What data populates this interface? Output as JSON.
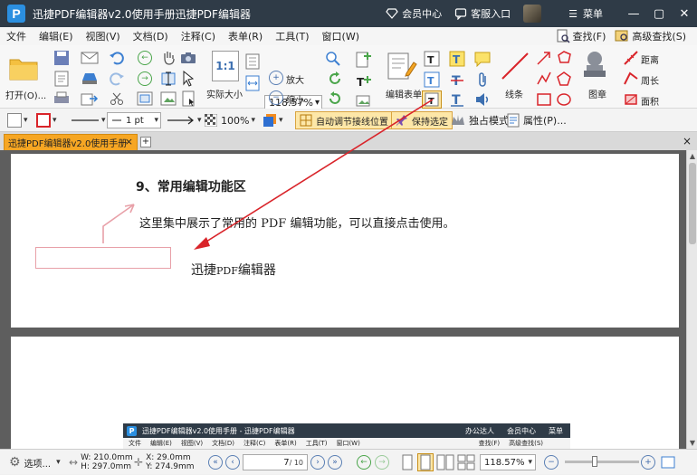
{
  "window": {
    "title": "迅捷PDF编辑器v2.0使用手册迅捷PDF编辑器",
    "logo_letter": "P",
    "member_label": "会员中心",
    "service_label": "客服入口",
    "menu_label": "菜单"
  },
  "menubar": {
    "items": [
      "文件",
      "编辑(E)",
      "视图(V)",
      "文档(D)",
      "注释(C)",
      "表单(R)",
      "工具(T)",
      "窗口(W)"
    ],
    "find_label": "查找(F)",
    "advanced_find_label": "高级查找(S)"
  },
  "ribbon": {
    "open_label": "打开(O)...",
    "zoom_value": "118.57%",
    "actual_size_label": "实际大小",
    "actual_size_glyph": "1:1",
    "zoom_in_label": "放大",
    "zoom_out_label": "缩小",
    "edit_form_label": "编辑表单",
    "line_label": "线条",
    "stamp_label": "图章",
    "distance_label": "距离",
    "perimeter_label": "周长",
    "area_label": "面积"
  },
  "propbar": {
    "line_width": "1 pt",
    "opacity": "100%",
    "auto_adjust_label": "自动调节接线位置",
    "keep_selected_label": "保持选定",
    "exclusive_mode_label": "独占模式",
    "properties_label": "属性(P)..."
  },
  "tabs": {
    "doc_tab_label": "迅捷PDF编辑器v2.0使用手册",
    "close_glyph": "×",
    "add_glyph": "+"
  },
  "document": {
    "heading": "9、常用编辑功能区",
    "paragraph": "这里集中展示了常用的 PDF 编辑功能，可以直接点击使用。",
    "brand_part1": "迅捷",
    "brand_part2": "PDF",
    "brand_part3": "编辑器"
  },
  "mini_window": {
    "title": "迅捷PDF编辑器v2.0使用手册 - 迅捷PDF编辑器",
    "office_label": "办公达人",
    "member_label": "会员中心",
    "menu_label": "菜单",
    "menu_items": [
      "文件",
      "编辑(E)",
      "视图(V)",
      "文档(D)",
      "注释(C)",
      "表单(R)",
      "工具(T)",
      "窗口(W)"
    ],
    "find_label": "查找(F)",
    "adv_label": "高级查找(S)"
  },
  "statusbar": {
    "options_label": "选项...",
    "width": "W: 210.0mm",
    "height": "H: 297.0mm",
    "x": "X:    29.0mm",
    "y": "Y:  274.9mm",
    "current_page": "7",
    "total_pages": "/ 10",
    "zoom_value": "118.57%"
  },
  "colors": {
    "titlebar": "#2f3b47",
    "tab_active": "#f6a623",
    "annotation_red": "#d9242a",
    "annotation_pink": "#e8a0a8",
    "toggle_bg": "#fde7a8"
  }
}
